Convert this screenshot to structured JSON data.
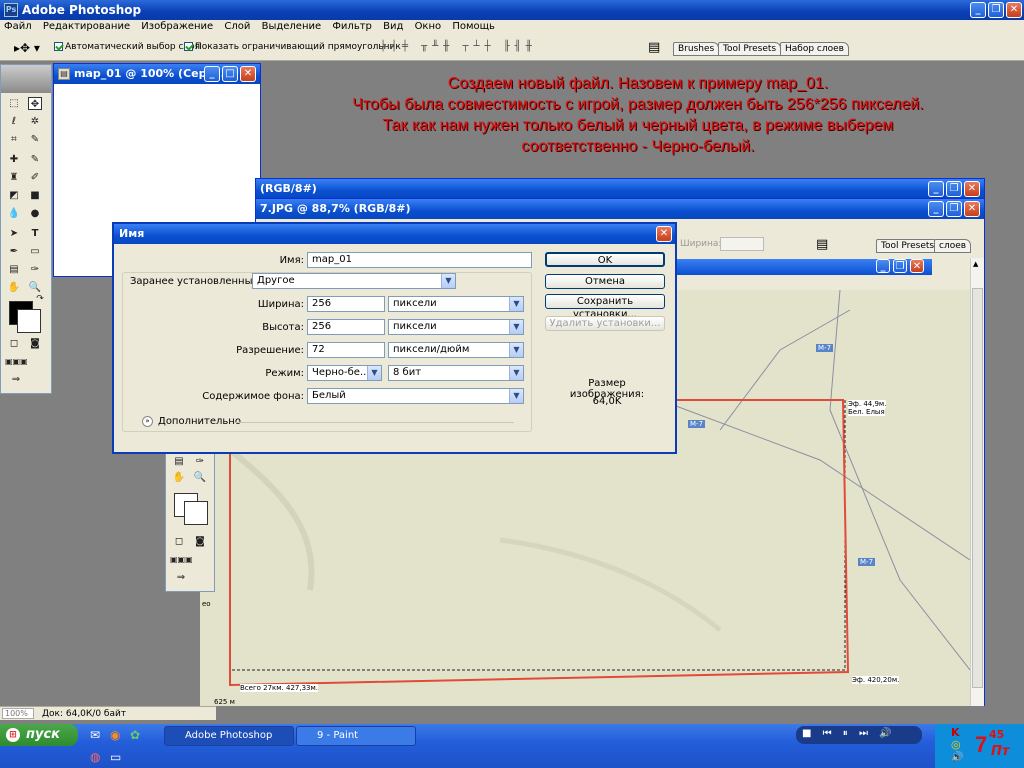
{
  "app": {
    "title": "Adobe Photoshop"
  },
  "menu": [
    "Файл",
    "Редактирование",
    "Изображение",
    "Слой",
    "Выделение",
    "Фильтр",
    "Вид",
    "Окно",
    "Помощь"
  ],
  "options": {
    "auto_select": "Автоматический выбор слоя",
    "show_bounds": "Показать ограничивающий прямоугольник"
  },
  "palette_tabs": [
    "Brushes",
    "Tool Presets",
    "Набор слоев"
  ],
  "new_doc_window": {
    "title": "map_01 @ 100% (Серы..."
  },
  "back_window": {
    "title": "(RGB/8#)"
  },
  "map_window": {
    "title": "7.JPG @ 88,7% (RGB/8#)"
  },
  "map_window_opts": {
    "width_label": "Ширина:",
    "tab": "Tool Presets",
    "tab2": "слоев"
  },
  "annotation": [
    "Создаем новый файл. Назовем к примеру map_01.",
    "Чтобы была совместимость с игрой, размер должен быть 256*256 пикселей.",
    "Так как нам нужен только белый и черный цвета, в режиме выберем",
    "соответственно - Черно-белый."
  ],
  "dialog": {
    "title": "Имя",
    "name_label": "Имя:",
    "name_value": "map_01",
    "preset_label": "Заранее установленные:",
    "preset_value": "Другое",
    "width_label": "Ширина:",
    "width_value": "256",
    "width_unit": "пиксели",
    "height_label": "Высота:",
    "height_value": "256",
    "height_unit": "пиксели",
    "res_label": "Разрешение:",
    "res_value": "72",
    "res_unit": "пиксели/дюйм",
    "mode_label": "Режим:",
    "mode_value": "Черно-бе...",
    "mode_depth": "8 бит",
    "bg_label": "Содержимое фона:",
    "bg_value": "Белый",
    "advanced": "Дополнительно",
    "ok": "OK",
    "cancel": "Отмена",
    "save_preset": "Сохранить установки...",
    "delete_preset": "Удалить установки...",
    "size_label": "Размер изображения:",
    "size_value": "64,0K"
  },
  "map": {
    "label_1": "Эф. 44,9м.",
    "label_1b": "Бел. Елыя",
    "label_total": "Всего  27км. 427,33м.",
    "label_end": "Эф. 420,20м.",
    "label_scale": "625 м",
    "side_label": "ео",
    "road_1": "М-7",
    "road_2": "М-7",
    "road_3": "М-7"
  },
  "status": {
    "zoom": "100%",
    "doc": "Док: 64,0К/0 байт"
  },
  "taskbar": {
    "start": "пуск",
    "items": [
      "Adobe Photoshop",
      "9 - Paint"
    ],
    "clock_h": "7",
    "clock_m": "45",
    "clock_day": "Пт"
  }
}
